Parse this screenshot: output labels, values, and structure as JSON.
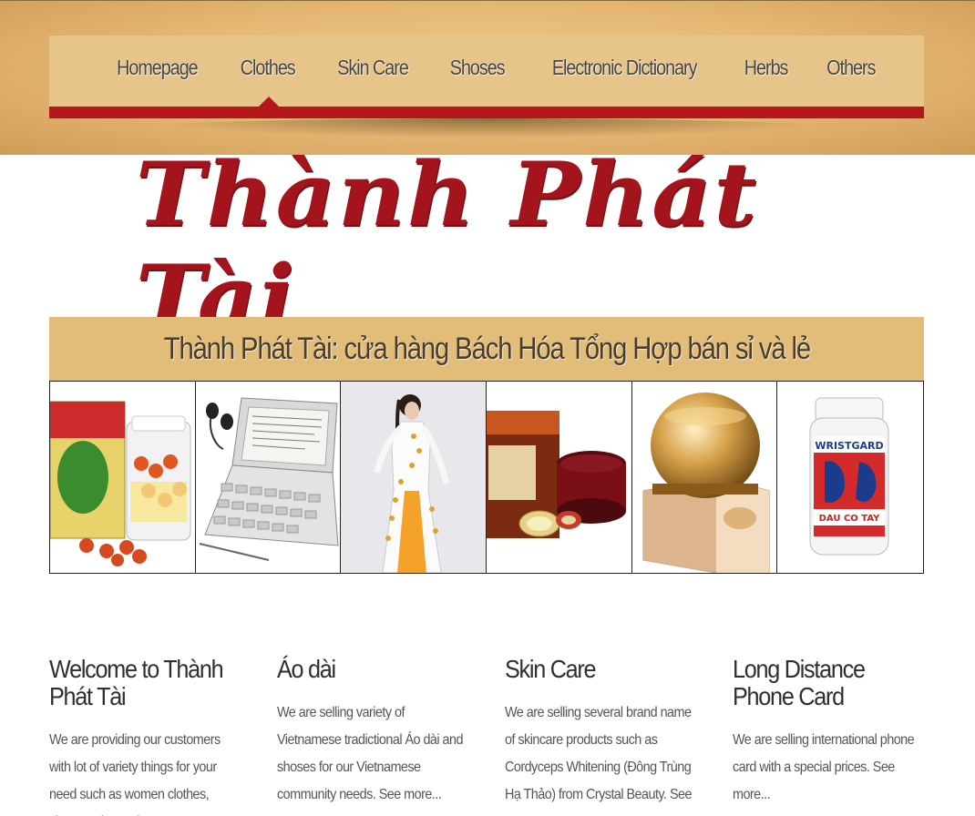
{
  "nav": {
    "items": [
      "Homepage",
      "Clothes",
      "Skin Care",
      "Shoses",
      "Electronic Dictionary",
      "Herbs",
      "Others"
    ],
    "active": "Homepage"
  },
  "logo": {
    "text": "Thành Phát Tài"
  },
  "tagline": "Thành Phát Tài: cửa hàng Bách Hóa Tổng Hợp bán sỉ và lẻ",
  "gallery": [
    {
      "name": "herbal-turmeric-product"
    },
    {
      "name": "electronic-dictionary-product"
    },
    {
      "name": "ao-dai-dress-product"
    },
    {
      "name": "ginseng-cream-product"
    },
    {
      "name": "freckle-cream-product"
    },
    {
      "name": "wrist-guard-herbal-product"
    }
  ],
  "columns": [
    {
      "title": "Welcome to Thành Phát Tài",
      "text": "We are providing our customers with lot of variety things for your need such as women clothes, shoses, electronic"
    },
    {
      "title": "Áo dài",
      "text": "We are selling variety of Vietnamese tradictional Áo dài and shoses for our Vietnamese community needs.",
      "link": "See more..."
    },
    {
      "title": "Skin Care",
      "text": "We are selling several brand name of skincare products such as Cordyceps Whitening (Đông Trùng Hạ Thảo) from Crystal Beauty.",
      "link": "See more..."
    },
    {
      "title": "Long Distance Phone Card",
      "text": "We are selling international phone card with a special prices.",
      "link": "See more..."
    }
  ],
  "colors": {
    "band": "#e4b672",
    "nav_bg": "#e6c48a",
    "accent_red": "#b5161c",
    "logo_red": "#a3141c",
    "tagline_bg": "#e2bd7a"
  }
}
